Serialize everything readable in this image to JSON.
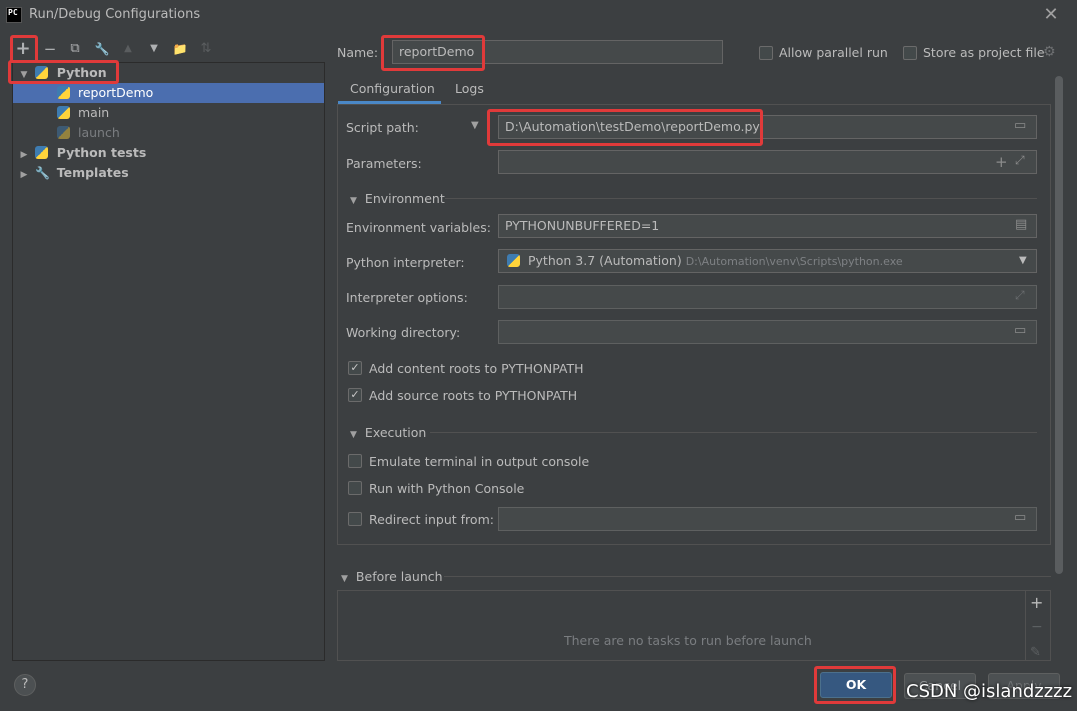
{
  "window": {
    "title": "Run/Debug Configurations",
    "app_icon": "PC",
    "close": "✕"
  },
  "toolbar": {
    "add": "+",
    "remove": "−",
    "copy": "⧉",
    "edit": "🔧",
    "move_up": "▲",
    "move_down": "▼",
    "new_folder": "📁",
    "sort": "⇅"
  },
  "tree": {
    "python": "Python",
    "report_demo": "reportDemo",
    "main": "main",
    "launch": "launch",
    "python_tests": "Python tests",
    "templates": "Templates"
  },
  "name_field": {
    "label": "Name:",
    "value": "reportDemo"
  },
  "options": {
    "allow_parallel": "Allow parallel run",
    "store_project": "Store as project file"
  },
  "tabs": {
    "configuration": "Configuration",
    "logs": "Logs"
  },
  "fields": {
    "script_path_label": "Script path:",
    "script_path_value": "D:\\Automation\\testDemo\\reportDemo.py",
    "parameters_label": "Parameters:",
    "environment": "Environment",
    "env_vars_label": "Environment variables:",
    "env_vars_value": "PYTHONUNBUFFERED=1",
    "interpreter_label": "Python interpreter:",
    "interpreter_value": "Python 3.7 (Automation)",
    "interpreter_path": "D:\\Automation\\venv\\Scripts\\python.exe",
    "interpreter_options_label": "Interpreter options:",
    "working_dir_label": "Working directory:",
    "add_content_roots": "Add content roots to PYTHONPATH",
    "add_source_roots": "Add source roots to PYTHONPATH",
    "execution": "Execution",
    "emulate_terminal": "Emulate terminal in output console",
    "run_python_console": "Run with Python Console",
    "redirect_input": "Redirect input from:"
  },
  "before_launch": {
    "title": "Before launch",
    "empty": "There are no tasks to run before launch",
    "add": "+",
    "remove": "−",
    "edit": "✎"
  },
  "buttons": {
    "ok": "OK",
    "cancel": "Cancel",
    "apply": "Apply",
    "help": "?"
  },
  "watermark": "CSDN @islandzzzz",
  "colors": {
    "background": "#3c3f41",
    "selection": "#4b6eaf",
    "highlight": "#e03a3a",
    "primary_button": "#365880"
  }
}
